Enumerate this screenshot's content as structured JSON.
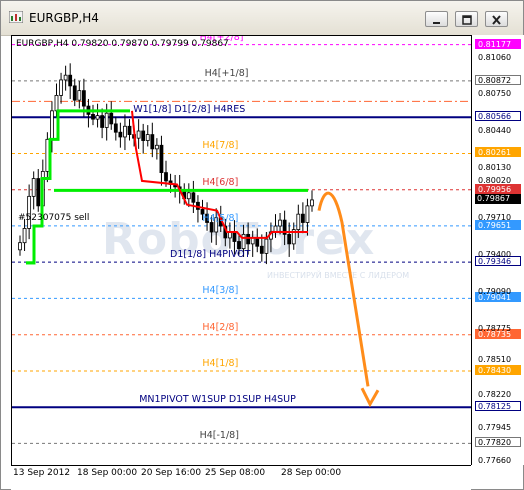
{
  "window": {
    "title": "EURGBP,H4",
    "icon": "chart-window-icon"
  },
  "controls": {
    "minimize": "minimize-icon",
    "restore": "restore-icon",
    "close": "close-icon"
  },
  "chart_info": {
    "symbol_line": "EURGBP,H4  0.79820 0.79870 0.79799 0.79867",
    "trade_note": "#52307075 sell",
    "watermark": "RoboForex",
    "watermark_sub": "ИНВЕСТИРУЙ ВМЕСТЕ С ЛИДЕРОМ"
  },
  "levels": [
    {
      "name": "H4[+2/8]",
      "price": 0.81177,
      "tag": "0.81177",
      "color": "#ff00ff",
      "label_color": "#ff00ff",
      "style": "dashed"
    },
    {
      "name": "H4[+1/8]",
      "price": 0.80872,
      "tag": "0.80872",
      "color": "#777777",
      "label_color": "#444444",
      "style": "dashed"
    },
    {
      "name": "",
      "price": 0.807,
      "tag": "",
      "color": "#ff6633",
      "label_color": "#ff6633",
      "style": "dashdot"
    },
    {
      "name": "W1[1/8] D1[2/8] H4RES",
      "price": 0.80566,
      "tag": "0.80566",
      "color": "#000080",
      "label_color": "#000080",
      "style": "solid"
    },
    {
      "name": "H4[7/8]",
      "price": 0.80261,
      "tag": "0.80261",
      "color": "#ffa500",
      "label_color": "#ffa500",
      "style": "dashed"
    },
    {
      "name": "H4[6/8]",
      "price": 0.79956,
      "tag": "0.79956",
      "color": "#dd3333",
      "label_color": "#dd3333",
      "style": "dashed"
    },
    {
      "name": "H4[5/8]",
      "price": 0.79651,
      "tag": "0.79651",
      "color": "#3399ff",
      "label_color": "#3399ff",
      "style": "dashed"
    },
    {
      "name": "D1[1/8] H4PIVOT",
      "price": 0.79346,
      "tag": "0.79346",
      "color": "#000080",
      "label_color": "#000080",
      "style": "dashed"
    },
    {
      "name": "H4[3/8]",
      "price": 0.79041,
      "tag": "0.79041",
      "color": "#3399ff",
      "label_color": "#3399ff",
      "style": "dashed"
    },
    {
      "name": "H4[2/8]",
      "price": 0.78735,
      "tag": "0.78735",
      "color": "#ff6633",
      "label_color": "#ff6633",
      "style": "dashed"
    },
    {
      "name": "H4[1/8]",
      "price": 0.7843,
      "tag": "0.78430",
      "color": "#ffa500",
      "label_color": "#ffa500",
      "style": "dashed"
    },
    {
      "name": "MN1PIVOT W1SUP D1SUP H4SUP",
      "price": 0.78125,
      "tag": "0.78125",
      "color": "#000080",
      "label_color": "#000080",
      "style": "solid"
    },
    {
      "name": "H4[-1/8]",
      "price": 0.7782,
      "tag": "0.77820",
      "color": "#777777",
      "label_color": "#444444",
      "style": "dashed"
    }
  ],
  "current_price": {
    "value": 0.79867,
    "tag": "0.79867"
  },
  "price_ticks": [
    "0.81060",
    "0.80750",
    "0.80440",
    "0.80130",
    "0.80020",
    "0.79710",
    "0.79400",
    "0.79090",
    "0.78775",
    "0.78510",
    "0.78220",
    "0.77945",
    "0.77660"
  ],
  "x_labels": [
    "13 Sep 2012",
    "18 Sep 00:00",
    "20 Sep 16:00",
    "25 Sep 08:00",
    "28 Sep 00:00"
  ],
  "colors": {
    "green_line": "#00ee00",
    "red_line": "#ff0000",
    "forecast_arrow": "#ff8c1a",
    "candle": "#000000"
  },
  "chart_data": {
    "type": "candlestick",
    "title": "EURGBP,H4",
    "ylim": [
      0.7763,
      0.8125
    ],
    "x_tick_labels": [
      "13 Sep 2012",
      "18 Sep 00:00",
      "20 Sep 16:00",
      "25 Sep 08:00",
      "28 Sep 00:00"
    ],
    "close_series": [
      0.7951,
      0.7963,
      0.799,
      0.8005,
      0.7982,
      0.8011,
      0.8038,
      0.8062,
      0.8075,
      0.8088,
      0.8092,
      0.8083,
      0.8071,
      0.8079,
      0.8066,
      0.8059,
      0.8055,
      0.8058,
      0.8048,
      0.806,
      0.8051,
      0.8044,
      0.804,
      0.8049,
      0.8042,
      0.8039,
      0.8045,
      0.8037,
      0.8042,
      0.803,
      0.8033,
      0.801,
      0.8003,
      0.8,
      0.7998,
      0.7995,
      0.7988,
      0.7993,
      0.7985,
      0.7979,
      0.7975,
      0.7968,
      0.796,
      0.7972,
      0.7965,
      0.7955,
      0.796,
      0.7952,
      0.7946,
      0.7958,
      0.795,
      0.7955,
      0.7948,
      0.7942,
      0.7954,
      0.796,
      0.7965,
      0.797,
      0.7958,
      0.795,
      0.7962,
      0.7975,
      0.7968,
      0.7982,
      0.7987
    ],
    "forecast": "down from 0.7995 to 0.7815"
  }
}
